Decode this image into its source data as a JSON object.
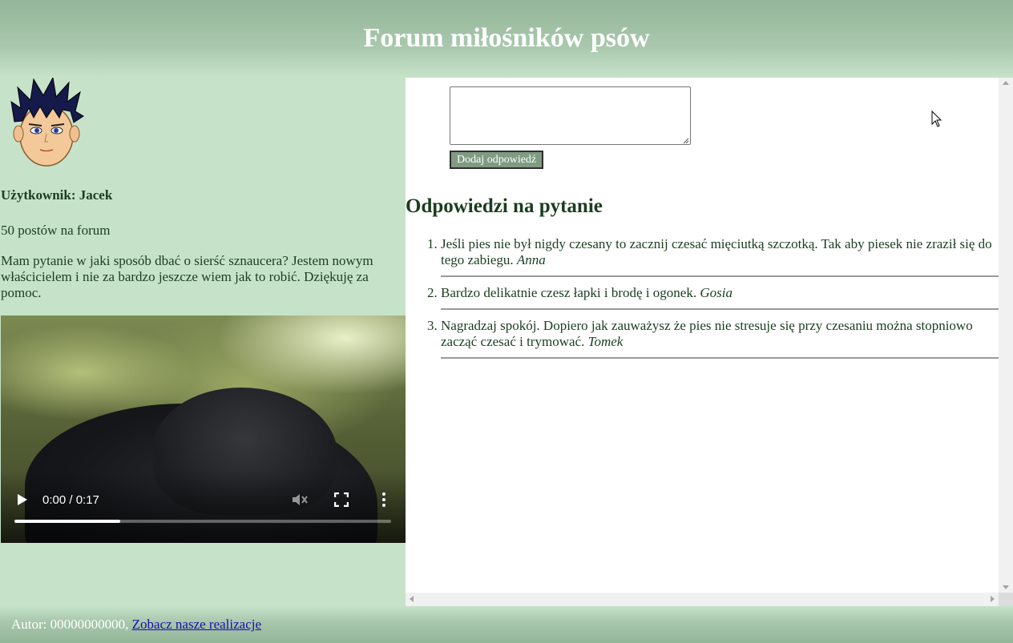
{
  "header": {
    "title": "Forum miłośników psów"
  },
  "user": {
    "name_line": "Użytkownik: Jacek",
    "posts_line": "50 postów na forum",
    "question": "Mam pytanie w jaki sposób dbać o sierść sznaucera? Jestem nowym właścicielem i nie za bardzo jeszcze wiem jak to robić. Dziękuję za pomoc."
  },
  "video": {
    "time": "0:00 / 0:17",
    "progress": 0.28,
    "icons": [
      "play-icon",
      "volume-muted-icon",
      "fullscreen-icon",
      "more-options-icon"
    ]
  },
  "reply": {
    "textarea_value": "",
    "button_label": "Dodaj odpowiedź"
  },
  "answers": {
    "title": "Odpowiedzi na pytanie",
    "items": [
      {
        "text": "Jeśli pies nie był nigdy czesany to zacznij czesać mięciutką szczotką. Tak aby piesek nie zraził się do tego zabiegu. ",
        "author": "Anna"
      },
      {
        "text": "Bardzo delikatnie czesz łapki i brodę i ogonek. ",
        "author": "Gosia"
      },
      {
        "text": "Nagradzaj spokój. Dopiero jak zauważysz że pies nie stresuje się przy czesaniu można stopniowo zacząć czesać i trymować. ",
        "author": "Tomek"
      }
    ]
  },
  "footer": {
    "text": "Autor: 00000000000, ",
    "link_label": "Zobacz nasze realizacje"
  },
  "colors": {
    "background": "#c6e3c9",
    "header": "#93b598",
    "button": "#7f9b82",
    "text": "#1b3d1f"
  }
}
